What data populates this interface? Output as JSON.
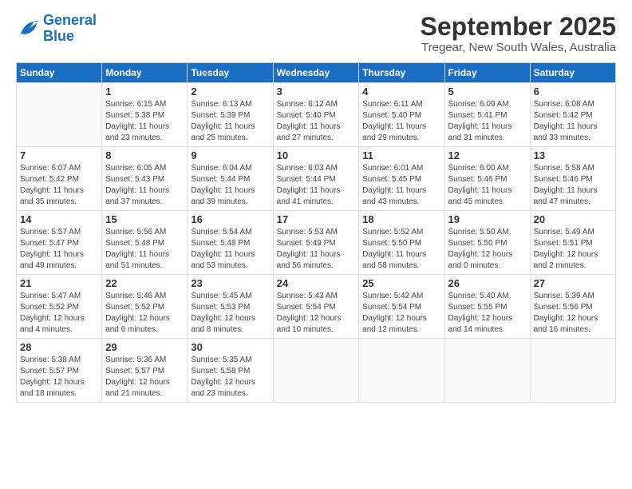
{
  "logo": {
    "text_general": "General",
    "text_blue": "Blue"
  },
  "header": {
    "month": "September 2025",
    "location": "Tregear, New South Wales, Australia"
  },
  "weekdays": [
    "Sunday",
    "Monday",
    "Tuesday",
    "Wednesday",
    "Thursday",
    "Friday",
    "Saturday"
  ],
  "weeks": [
    [
      {
        "day": "",
        "info": ""
      },
      {
        "day": "1",
        "info": "Sunrise: 6:15 AM\nSunset: 5:38 PM\nDaylight: 11 hours\nand 23 minutes."
      },
      {
        "day": "2",
        "info": "Sunrise: 6:13 AM\nSunset: 5:39 PM\nDaylight: 11 hours\nand 25 minutes."
      },
      {
        "day": "3",
        "info": "Sunrise: 6:12 AM\nSunset: 5:40 PM\nDaylight: 11 hours\nand 27 minutes."
      },
      {
        "day": "4",
        "info": "Sunrise: 6:11 AM\nSunset: 5:40 PM\nDaylight: 11 hours\nand 29 minutes."
      },
      {
        "day": "5",
        "info": "Sunrise: 6:09 AM\nSunset: 5:41 PM\nDaylight: 11 hours\nand 31 minutes."
      },
      {
        "day": "6",
        "info": "Sunrise: 6:08 AM\nSunset: 5:42 PM\nDaylight: 11 hours\nand 33 minutes."
      }
    ],
    [
      {
        "day": "7",
        "info": "Sunrise: 6:07 AM\nSunset: 5:42 PM\nDaylight: 11 hours\nand 35 minutes."
      },
      {
        "day": "8",
        "info": "Sunrise: 6:05 AM\nSunset: 5:43 PM\nDaylight: 11 hours\nand 37 minutes."
      },
      {
        "day": "9",
        "info": "Sunrise: 6:04 AM\nSunset: 5:44 PM\nDaylight: 11 hours\nand 39 minutes."
      },
      {
        "day": "10",
        "info": "Sunrise: 6:03 AM\nSunset: 5:44 PM\nDaylight: 11 hours\nand 41 minutes."
      },
      {
        "day": "11",
        "info": "Sunrise: 6:01 AM\nSunset: 5:45 PM\nDaylight: 11 hours\nand 43 minutes."
      },
      {
        "day": "12",
        "info": "Sunrise: 6:00 AM\nSunset: 5:46 PM\nDaylight: 11 hours\nand 45 minutes."
      },
      {
        "day": "13",
        "info": "Sunrise: 5:58 AM\nSunset: 5:46 PM\nDaylight: 11 hours\nand 47 minutes."
      }
    ],
    [
      {
        "day": "14",
        "info": "Sunrise: 5:57 AM\nSunset: 5:47 PM\nDaylight: 11 hours\nand 49 minutes."
      },
      {
        "day": "15",
        "info": "Sunrise: 5:56 AM\nSunset: 5:48 PM\nDaylight: 11 hours\nand 51 minutes."
      },
      {
        "day": "16",
        "info": "Sunrise: 5:54 AM\nSunset: 5:48 PM\nDaylight: 11 hours\nand 53 minutes."
      },
      {
        "day": "17",
        "info": "Sunrise: 5:53 AM\nSunset: 5:49 PM\nDaylight: 11 hours\nand 56 minutes."
      },
      {
        "day": "18",
        "info": "Sunrise: 5:52 AM\nSunset: 5:50 PM\nDaylight: 11 hours\nand 58 minutes."
      },
      {
        "day": "19",
        "info": "Sunrise: 5:50 AM\nSunset: 5:50 PM\nDaylight: 12 hours\nand 0 minutes."
      },
      {
        "day": "20",
        "info": "Sunrise: 5:49 AM\nSunset: 5:51 PM\nDaylight: 12 hours\nand 2 minutes."
      }
    ],
    [
      {
        "day": "21",
        "info": "Sunrise: 5:47 AM\nSunset: 5:52 PM\nDaylight: 12 hours\nand 4 minutes."
      },
      {
        "day": "22",
        "info": "Sunrise: 5:46 AM\nSunset: 5:52 PM\nDaylight: 12 hours\nand 6 minutes."
      },
      {
        "day": "23",
        "info": "Sunrise: 5:45 AM\nSunset: 5:53 PM\nDaylight: 12 hours\nand 8 minutes."
      },
      {
        "day": "24",
        "info": "Sunrise: 5:43 AM\nSunset: 5:54 PM\nDaylight: 12 hours\nand 10 minutes."
      },
      {
        "day": "25",
        "info": "Sunrise: 5:42 AM\nSunset: 5:54 PM\nDaylight: 12 hours\nand 12 minutes."
      },
      {
        "day": "26",
        "info": "Sunrise: 5:40 AM\nSunset: 5:55 PM\nDaylight: 12 hours\nand 14 minutes."
      },
      {
        "day": "27",
        "info": "Sunrise: 5:39 AM\nSunset: 5:56 PM\nDaylight: 12 hours\nand 16 minutes."
      }
    ],
    [
      {
        "day": "28",
        "info": "Sunrise: 5:38 AM\nSunset: 5:57 PM\nDaylight: 12 hours\nand 18 minutes."
      },
      {
        "day": "29",
        "info": "Sunrise: 5:36 AM\nSunset: 5:57 PM\nDaylight: 12 hours\nand 21 minutes."
      },
      {
        "day": "30",
        "info": "Sunrise: 5:35 AM\nSunset: 5:58 PM\nDaylight: 12 hours\nand 23 minutes."
      },
      {
        "day": "",
        "info": ""
      },
      {
        "day": "",
        "info": ""
      },
      {
        "day": "",
        "info": ""
      },
      {
        "day": "",
        "info": ""
      }
    ]
  ]
}
